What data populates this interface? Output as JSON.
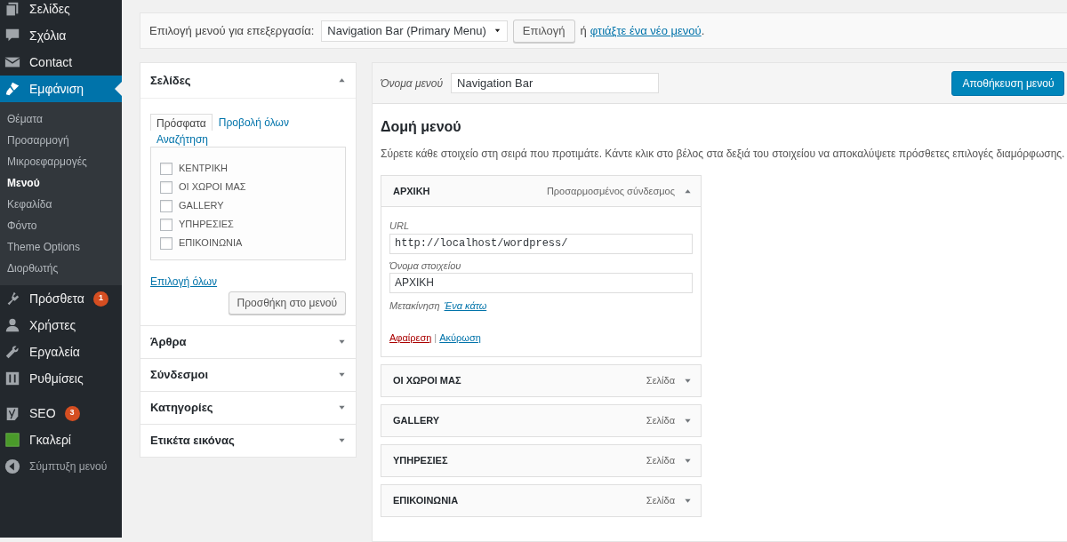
{
  "sidebar": {
    "groups": [
      [
        {
          "label": "Σελίδες",
          "selected": false
        },
        {
          "label": "Σχόλια",
          "selected": false
        },
        {
          "label": "Contact",
          "selected": false
        },
        {
          "label": "Εμφάνιση",
          "selected": true,
          "children": [
            {
              "label": "Θέματα",
              "selected": false
            },
            {
              "label": "Προσαρμογή",
              "selected": false
            },
            {
              "label": "Μικροεφαρμογές",
              "selected": false
            },
            {
              "label": "Μενού",
              "selected": true
            },
            {
              "label": "Κεφαλίδα",
              "selected": false
            },
            {
              "label": "Φόντο",
              "selected": false
            },
            {
              "label": "Theme Options",
              "selected": false
            },
            {
              "label": "Διορθωτής",
              "selected": false
            }
          ]
        },
        {
          "label": "Πρόσθετα",
          "selected": false,
          "badge": "1"
        },
        {
          "label": "Χρήστες",
          "selected": false
        },
        {
          "label": "Εργαλεία",
          "selected": false
        },
        {
          "label": "Ρυθμίσεις",
          "selected": false
        }
      ],
      [
        {
          "label": "SEO",
          "selected": false,
          "badge": "3"
        },
        {
          "label": "Γκαλερί",
          "selected": false
        }
      ]
    ],
    "collapse": "Σύμπτυξη μενού"
  },
  "menu_select": {
    "label": "Επιλογή μενού για επεξεργασία:",
    "value": "Navigation Bar (Primary Menu)",
    "button": "Επιλογή",
    "or": "ή",
    "link": "φτιάξτε ένα νέο μενού",
    "period": "."
  },
  "pages_panel": {
    "title": "Σελίδες",
    "expanded": true,
    "tabs": [
      {
        "label": "Πρόσφατα",
        "selected": true
      },
      {
        "label": "Προβολή όλων",
        "selected": false
      },
      {
        "label": "Αναζήτηση",
        "selected": false
      }
    ],
    "items": [
      {
        "label": "ΚΕΝΤΡΙΚΗ",
        "checked": false
      },
      {
        "label": "ΟΙ ΧΩΡΟΙ ΜΑΣ",
        "checked": false
      },
      {
        "label": "GALLERY",
        "checked": false
      },
      {
        "label": "ΥΠΗΡΕΣΙΕΣ",
        "checked": false
      },
      {
        "label": "ΕΠΙΚΟΙΝΩΝΙΑ",
        "checked": false
      }
    ],
    "select_all": "Επιλογή όλων",
    "add_button": "Προσθήκη στο μενού"
  },
  "other_panels": [
    {
      "title": "Άρθρα",
      "expanded": false
    },
    {
      "title": "Σύνδεσμοι",
      "expanded": false
    },
    {
      "title": "Κατηγορίες",
      "expanded": false
    },
    {
      "title": "Ετικέτα εικόνας",
      "expanded": false
    }
  ],
  "menu_editor": {
    "name_label": "Όνομα μενού",
    "name_value": "Navigation Bar",
    "save_button": "Αποθήκευση μενού",
    "heading": "Δομή μενού",
    "instructions": "Σύρετε κάθε στοιχείο στη σειρά που προτιμάτε. Κάντε κλικ στο βέλος στα δεξιά του στοιχείου να αποκαλύψετε πρόσθετες επιλογές διαμόρφωσης.",
    "items": [
      {
        "title": "ΑΡΧΙΚΗ",
        "type": "Προσαρμοσμένος σύνδεσμος",
        "expanded": true,
        "url_label": "URL",
        "url_value": "http://localhost/wordpress/",
        "name_label": "Όνομα στοιχείου",
        "name_value": "ΑΡΧΙΚΗ",
        "move_label": "Μετακίνηση",
        "move_link": "Ένα κάτω",
        "remove": "Αφαίρεση",
        "separator": "|",
        "cancel": "Ακύρωση"
      },
      {
        "title": "ΟΙ ΧΩΡΟΙ ΜΑΣ",
        "type": "Σελίδα",
        "expanded": false
      },
      {
        "title": "GALLERY",
        "type": "Σελίδα",
        "expanded": false
      },
      {
        "title": "ΥΠΗΡΕΣΙΕΣ",
        "type": "Σελίδα",
        "expanded": false
      },
      {
        "title": "ΕΠΙΚΟΙΝΩΝΙΑ",
        "type": "Σελίδα",
        "expanded": false
      }
    ]
  }
}
